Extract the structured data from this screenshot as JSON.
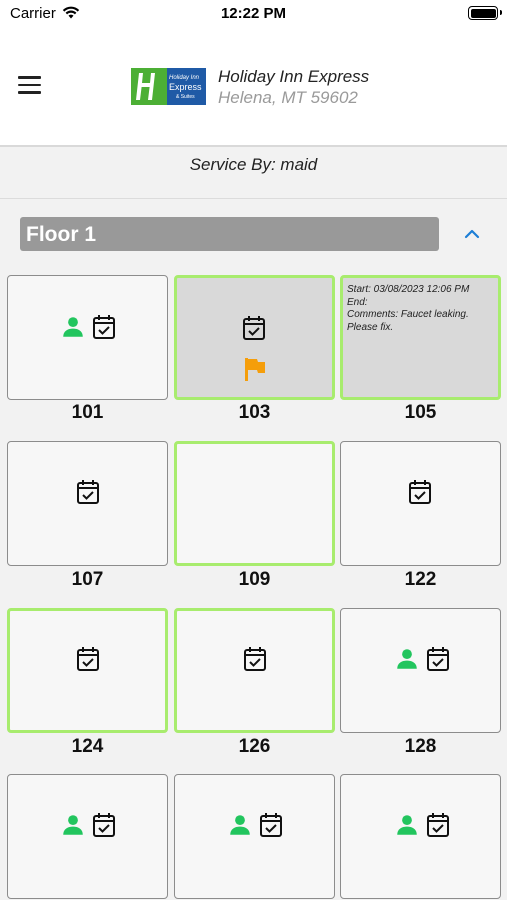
{
  "status": {
    "carrier": "Carrier",
    "time": "12:22 PM"
  },
  "hotel": {
    "name": "Holiday Inn Express",
    "address": "Helena, MT 59602"
  },
  "service": {
    "label": "Service By: maid"
  },
  "floor": {
    "title": "Floor 1"
  },
  "colors": {
    "highlight": "#a8ec6e",
    "person": "#22c55e",
    "flag": "#f59e0b"
  },
  "rooms": [
    {
      "number": "101",
      "icons": [
        "person-icon",
        "calendar-check-icon"
      ]
    },
    {
      "number": "103",
      "icons": [
        "calendar-check-icon",
        "flag-icon"
      ]
    },
    {
      "number": "105",
      "note": {
        "start": "Start: 03/08/2023 12:06 PM",
        "end": "End:",
        "comments": "Comments: Faucet leaking.",
        "extra": "Please fix."
      }
    },
    {
      "number": "107",
      "icons": [
        "calendar-check-icon"
      ]
    },
    {
      "number": "109",
      "icons": []
    },
    {
      "number": "122",
      "icons": [
        "calendar-check-icon"
      ]
    },
    {
      "number": "124",
      "icons": [
        "calendar-check-icon"
      ]
    },
    {
      "number": "126",
      "icons": [
        "calendar-check-icon"
      ]
    },
    {
      "number": "128",
      "icons": [
        "person-icon",
        "calendar-check-icon"
      ]
    },
    {
      "number": "",
      "icons": [
        "person-icon",
        "calendar-check-icon"
      ]
    },
    {
      "number": "",
      "icons": [
        "person-icon",
        "calendar-check-icon"
      ]
    },
    {
      "number": "",
      "icons": [
        "person-icon",
        "calendar-check-icon"
      ]
    }
  ]
}
